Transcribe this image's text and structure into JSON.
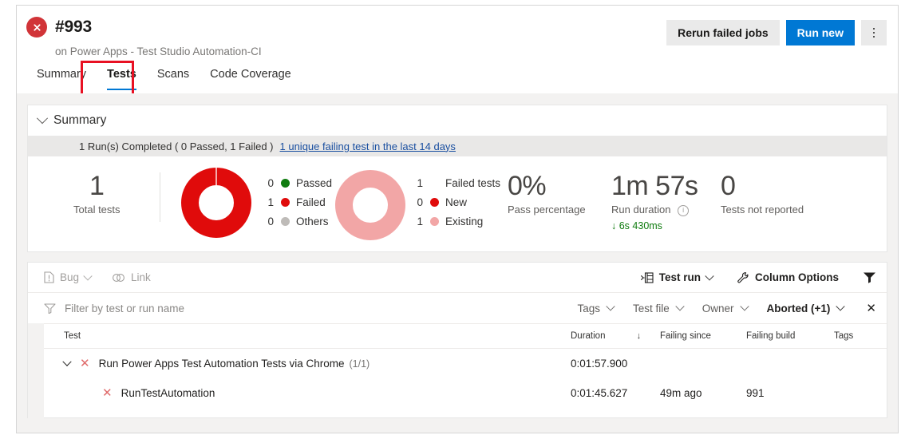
{
  "header": {
    "status_icon": "error-circle-icon",
    "build_number": "#993",
    "subtitle": "on Power Apps - Test Studio Automation-CI",
    "actions": {
      "rerun_label": "Rerun failed jobs",
      "run_new_label": "Run new",
      "more_label": "more-options"
    },
    "tabs": [
      {
        "label": "Summary",
        "active": false
      },
      {
        "label": "Tests",
        "active": true
      },
      {
        "label": "Scans",
        "active": false
      },
      {
        "label": "Code Coverage",
        "active": false
      }
    ]
  },
  "summary": {
    "section_title": "Summary",
    "banner_text": "1 Run(s) Completed ( 0 Passed, 1 Failed )",
    "banner_link": "1 unique failing test in the last 14 days",
    "total": {
      "value": "1",
      "label": "Total tests"
    },
    "outcome_legend": [
      {
        "count": "0",
        "label": "Passed",
        "color": "#107c10"
      },
      {
        "count": "1",
        "label": "Failed",
        "color": "#e00b0b"
      },
      {
        "count": "0",
        "label": "Others",
        "color": "#bebbb8"
      }
    ],
    "failed_legend": [
      {
        "count": "1",
        "label": "Failed tests",
        "color": ""
      },
      {
        "count": "0",
        "label": "New",
        "color": "#e00b0b"
      },
      {
        "count": "1",
        "label": "Existing",
        "color": "#f2a6a6"
      }
    ],
    "pass_percentage": {
      "value": "0%",
      "label": "Pass percentage"
    },
    "run_duration": {
      "value": "1m 57s",
      "label": "Run duration",
      "delta": "6s 430ms",
      "delta_direction": "down"
    },
    "not_reported": {
      "value": "0",
      "label": "Tests not reported"
    }
  },
  "results": {
    "toolbar": {
      "bug_label": "Bug",
      "link_label": "Link",
      "test_run_label": "Test run",
      "column_options_label": "Column Options",
      "filter_icon": "funnel-icon"
    },
    "filters": {
      "search_placeholder": "Filter by test or run name",
      "tags_label": "Tags",
      "test_file_label": "Test file",
      "owner_label": "Owner",
      "outcome_label": "Aborted (+1)",
      "clear_label": "close-icon"
    },
    "columns": [
      "Test",
      "Duration",
      "Failing since",
      "Failing build",
      "Tags"
    ],
    "sorted_column": "Duration",
    "sort_direction": "descending",
    "rows": [
      {
        "level": "parent",
        "expanded": true,
        "status": "failed",
        "test": "Run Power Apps Test Automation Tests via Chrome",
        "count": "(1/1)",
        "duration": "0:01:57.900",
        "failing_since": "",
        "failing_build": "",
        "tags": ""
      },
      {
        "level": "child",
        "status": "failed",
        "test": "RunTestAutomation",
        "count": "",
        "duration": "0:01:45.627",
        "failing_since": "49m ago",
        "failing_build": "991",
        "tags": ""
      }
    ]
  }
}
